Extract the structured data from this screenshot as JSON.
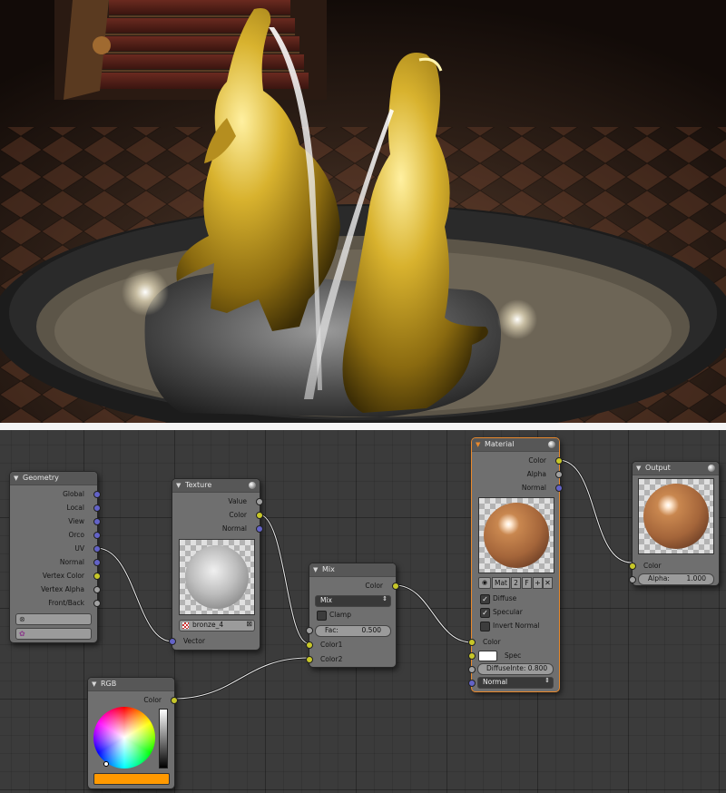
{
  "render_image": {
    "description_icon": "render-preview"
  },
  "nodes": {
    "geometry": {
      "title": "Geometry",
      "outputs": [
        "Global",
        "Local",
        "View",
        "Orco",
        "UV",
        "Normal",
        "Vertex Color",
        "Vertex Alpha",
        "Front/Back"
      ]
    },
    "texture": {
      "title": "Texture",
      "outputs": [
        "Value",
        "Color",
        "Normal"
      ],
      "texture_name": "bronze_4",
      "input": "Vector"
    },
    "mix": {
      "title": "Mix",
      "output": "Color",
      "blend_mode": "Mix",
      "clamp_label": "Clamp",
      "fac_label": "Fac:",
      "fac_value": "0.500",
      "inputs": [
        "Color1",
        "Color2"
      ]
    },
    "rgb": {
      "title": "RGB",
      "output": "Color",
      "swatch_color": "#ff9900"
    },
    "material": {
      "title": "Material",
      "outputs": [
        "Color",
        "Alpha",
        "Normal"
      ],
      "mat_name": "Mat",
      "users": "2",
      "fake": "F",
      "diffuse_label": "Diffuse",
      "specular_label": "Specular",
      "invert_normal_label": "Invert Normal",
      "inputs": {
        "color": "Color",
        "spec": "Spec",
        "diffuse_intensity": "DiffuseInte: 0.800",
        "normal": "Normal"
      }
    },
    "output": {
      "title": "Output",
      "input": "Color",
      "alpha_label": "Alpha:",
      "alpha_value": "1.000"
    }
  },
  "colors": {
    "socket_vector": "#6363c7",
    "socket_color": "#c7c729",
    "socket_value": "#a1a1a1",
    "selected_outline": "#e8892c"
  }
}
